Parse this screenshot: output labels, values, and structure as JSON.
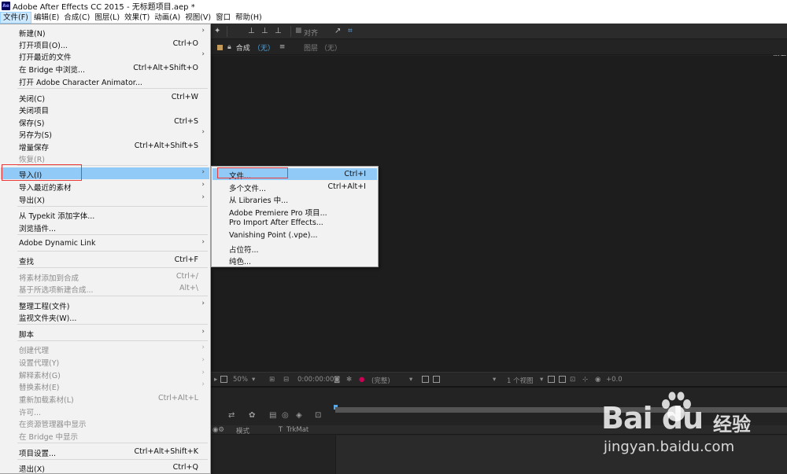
{
  "window": {
    "app_icon_text": "Ae",
    "title": "Adobe After Effects CC 2015 - 无标题项目.aep *"
  },
  "menubar": {
    "items": [
      {
        "label": "文件(F)"
      },
      {
        "label": "编辑(E)"
      },
      {
        "label": "合成(C)"
      },
      {
        "label": "图层(L)"
      },
      {
        "label": "效果(T)"
      },
      {
        "label": "动画(A)"
      },
      {
        "label": "视图(V)"
      },
      {
        "label": "窗口"
      },
      {
        "label": "帮助(H)"
      }
    ]
  },
  "toolbar": {
    "align_label": "对齐",
    "workspace_label": "必要"
  },
  "composition_panel": {
    "tab_label": "合成",
    "tab_value": "（无）",
    "tab_menu": "≡",
    "layer_tab": "图层 （无）"
  },
  "comp_bar": {
    "zoom": "50%",
    "timecode": "0:00:00:00",
    "quality": "(完整)",
    "views": "1 个视图",
    "exposure": "+0.0"
  },
  "timeline": {
    "mode_label": "模式",
    "t_label": "T",
    "trkmat_label": "TrkMat"
  },
  "file_menu": {
    "items": [
      {
        "label": "新建(N)",
        "shortcut": "",
        "arrow": "›",
        "disabled": false
      },
      {
        "label": "打开项目(O)...",
        "shortcut": "Ctrl+O",
        "arrow": "",
        "disabled": false
      },
      {
        "label": "打开最近的文件",
        "shortcut": "",
        "arrow": "›",
        "disabled": false
      },
      {
        "label": "在 Bridge 中浏览...",
        "shortcut": "Ctrl+Alt+Shift+O",
        "arrow": "",
        "disabled": false
      },
      {
        "label": "打开 Adobe Character Animator...",
        "shortcut": "",
        "arrow": "",
        "disabled": false
      },
      {
        "label": "关闭(C)",
        "shortcut": "Ctrl+W",
        "arrow": "",
        "disabled": false
      },
      {
        "label": "关闭项目",
        "shortcut": "",
        "arrow": "",
        "disabled": false
      },
      {
        "label": "保存(S)",
        "shortcut": "Ctrl+S",
        "arrow": "",
        "disabled": false
      },
      {
        "label": "另存为(S)",
        "shortcut": "",
        "arrow": "›",
        "disabled": false
      },
      {
        "label": "增量保存",
        "shortcut": "Ctrl+Alt+Shift+S",
        "arrow": "",
        "disabled": false
      },
      {
        "label": "恢复(R)",
        "shortcut": "",
        "arrow": "",
        "disabled": true
      },
      {
        "label": "导入(I)",
        "shortcut": "",
        "arrow": "›",
        "disabled": false
      },
      {
        "label": "导入最近的素材",
        "shortcut": "",
        "arrow": "›",
        "disabled": false
      },
      {
        "label": "导出(X)",
        "shortcut": "",
        "arrow": "›",
        "disabled": false
      },
      {
        "label": "从 Typekit 添加字体...",
        "shortcut": "",
        "arrow": "",
        "disabled": false
      },
      {
        "label": "浏览插件...",
        "shortcut": "",
        "arrow": "",
        "disabled": false
      },
      {
        "label": "Adobe Dynamic Link",
        "shortcut": "",
        "arrow": "›",
        "disabled": false
      },
      {
        "label": "查找",
        "shortcut": "Ctrl+F",
        "arrow": "",
        "disabled": false
      },
      {
        "label": "将素材添加到合成",
        "shortcut": "Ctrl+/",
        "arrow": "",
        "disabled": true
      },
      {
        "label": "基于所选项新建合成...",
        "shortcut": "Alt+\\",
        "arrow": "",
        "disabled": true
      },
      {
        "label": "整理工程(文件)",
        "shortcut": "",
        "arrow": "›",
        "disabled": false
      },
      {
        "label": "监视文件夹(W)...",
        "shortcut": "",
        "arrow": "",
        "disabled": false
      },
      {
        "label": "脚本",
        "shortcut": "",
        "arrow": "›",
        "disabled": false
      },
      {
        "label": "创建代理",
        "shortcut": "",
        "arrow": "›",
        "disabled": true
      },
      {
        "label": "设置代理(Y)",
        "shortcut": "",
        "arrow": "›",
        "disabled": true
      },
      {
        "label": "解释素材(G)",
        "shortcut": "",
        "arrow": "›",
        "disabled": true
      },
      {
        "label": "替换素材(E)",
        "shortcut": "",
        "arrow": "›",
        "disabled": true
      },
      {
        "label": "重新加载素材(L)",
        "shortcut": "Ctrl+Alt+L",
        "arrow": "",
        "disabled": true
      },
      {
        "label": "许可...",
        "shortcut": "",
        "arrow": "",
        "disabled": true
      },
      {
        "label": "在资源管理器中显示",
        "shortcut": "",
        "arrow": "",
        "disabled": true
      },
      {
        "label": "在 Bridge 中显示",
        "shortcut": "",
        "arrow": "",
        "disabled": true
      },
      {
        "label": "项目设置...",
        "shortcut": "Ctrl+Alt+Shift+K",
        "arrow": "",
        "disabled": false
      },
      {
        "label": "退出(X)",
        "shortcut": "Ctrl+Q",
        "arrow": "",
        "disabled": false
      }
    ]
  },
  "import_submenu": {
    "items": [
      {
        "label": "文件...",
        "shortcut": "Ctrl+I"
      },
      {
        "label": "多个文件...",
        "shortcut": "Ctrl+Alt+I"
      },
      {
        "label": "从 Libraries 中...",
        "shortcut": ""
      },
      {
        "label": "Adobe Premiere Pro 项目...",
        "shortcut": ""
      },
      {
        "label": "Pro Import After Effects...",
        "shortcut": ""
      },
      {
        "label": "Vanishing Point (.vpe)...",
        "shortcut": ""
      },
      {
        "label": "占位符...",
        "shortcut": ""
      },
      {
        "label": "纯色...",
        "shortcut": ""
      }
    ]
  },
  "watermark": {
    "logo_text": "Bai du",
    "cn_text": "经验",
    "url": "jingyan.baidu.com"
  },
  "colors": {
    "menu_highlight": "#91c9f7",
    "annotation_red": "#e83a3a",
    "ae_dark": "#232323"
  }
}
